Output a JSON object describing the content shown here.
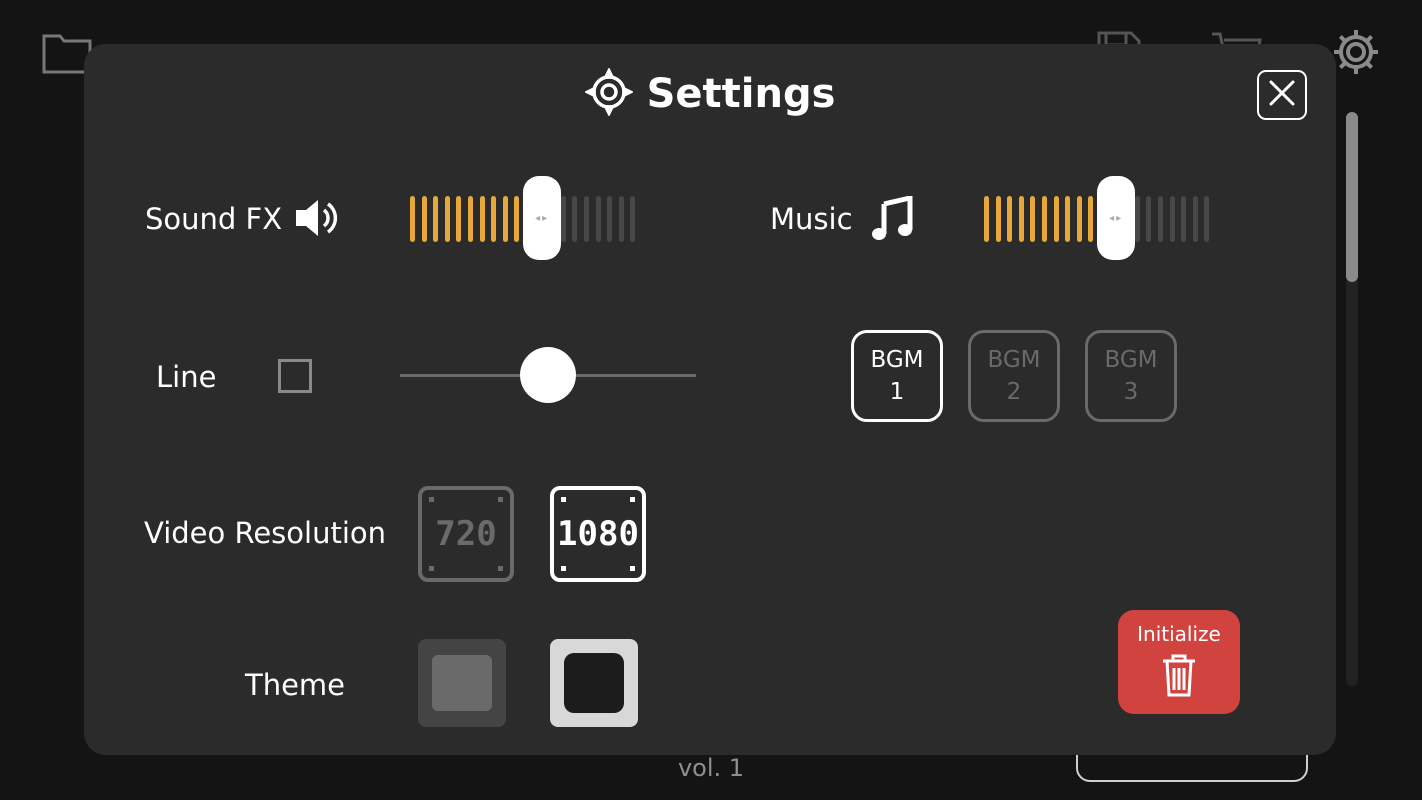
{
  "background": {
    "volume_text": "vol. 1",
    "icons": [
      "folder-icon",
      "save-icon",
      "cart-icon",
      "gear-icon"
    ]
  },
  "settings": {
    "title": "Settings",
    "sound_fx": {
      "label": "Sound FX",
      "icon": "speaker-icon",
      "level": 0.6,
      "segments": 20
    },
    "music": {
      "label": "Music",
      "icon": "music-note-icon",
      "level": 0.6,
      "segments": 20
    },
    "line": {
      "label": "Line",
      "checked": false,
      "level": 0.5
    },
    "bgm": [
      {
        "line1": "BGM",
        "line2": "1",
        "active": true
      },
      {
        "line1": "BGM",
        "line2": "2",
        "active": false
      },
      {
        "line1": "BGM",
        "line2": "3",
        "active": false
      }
    ],
    "video_resolution": {
      "label": "Video Resolution",
      "options": [
        {
          "label": "720",
          "active": false
        },
        {
          "label": "1080",
          "active": true
        }
      ]
    },
    "theme": {
      "label": "Theme",
      "selected": "dark"
    },
    "initialize": {
      "label": "Initialize",
      "icon": "trash-icon"
    }
  },
  "colors": {
    "accent": "#e9a93a",
    "danger": "#d0433e",
    "panel": "#2b2b2b"
  }
}
